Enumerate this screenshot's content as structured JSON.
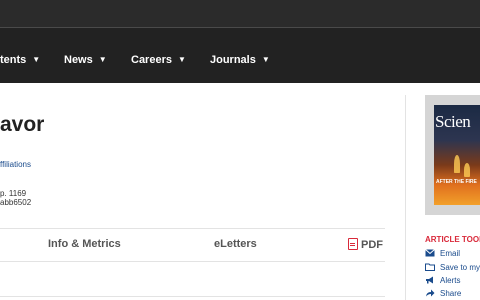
{
  "nav": {
    "items": [
      {
        "label": "tents"
      },
      {
        "label": "News"
      },
      {
        "label": "Careers"
      },
      {
        "label": "Journals"
      }
    ]
  },
  "article": {
    "title": "avor",
    "affiliations": "ffiliations",
    "page": "p. 1169",
    "doi": "abb6502"
  },
  "tabs": {
    "info": "Info & Metrics",
    "eletters": "eLetters",
    "pdf": "PDF"
  },
  "cover": {
    "title": "Scien",
    "subtitle": "AFTER THE FIRE"
  },
  "tools": {
    "heading": "ARTICLE TOOL",
    "items": [
      {
        "label": "Email",
        "icon": "envelope-icon"
      },
      {
        "label": "Save to my",
        "icon": "folder-icon"
      },
      {
        "label": "Alerts",
        "icon": "megaphone-icon"
      },
      {
        "label": "Share",
        "icon": "share-arrow-icon"
      }
    ]
  },
  "colors": {
    "nav_bg": "#222222",
    "accent_red": "#d9293a",
    "link_blue": "#1a4b8c"
  }
}
